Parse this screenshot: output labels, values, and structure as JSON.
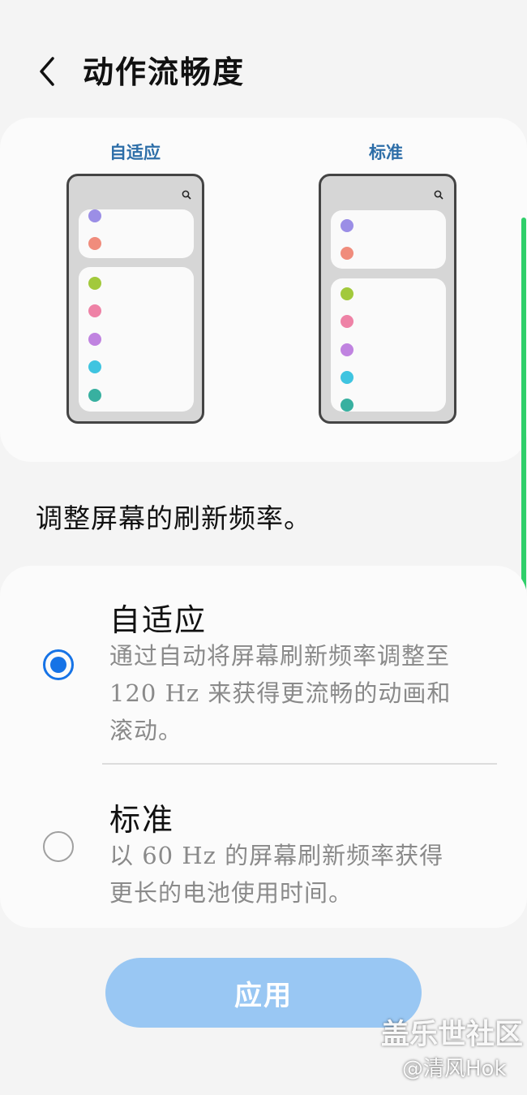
{
  "header": {
    "title": "动作流畅度",
    "back_icon": "chevron-left-icon"
  },
  "preview": {
    "adaptive_label": "自适应",
    "standard_label": "标准",
    "search_icon": "search-icon",
    "dot_colors": [
      "#9b8ee6",
      "#f08c7c",
      "#a2c93c",
      "#ee82a6",
      "#c083e0",
      "#3fc4e0",
      "#38b0a0"
    ]
  },
  "description": "调整屏幕的刷新频率。",
  "options": [
    {
      "title": "自适应",
      "desc_line1": "通过自动将屏幕刷新频率调整至",
      "desc_line2": "120 Hz 来获得更流畅的动画和",
      "desc_line3": "滚动。",
      "selected": true
    },
    {
      "title": "标准",
      "desc_line1": "以 60 Hz 的屏幕刷新频率获得",
      "desc_line2": "更长的电池使用时间。",
      "selected": false
    }
  ],
  "apply_label": "应用",
  "colors": {
    "accent": "#1673e6",
    "button_bg": "#99c7f3",
    "scroll_indicator": "#2fcf6a"
  },
  "watermark": {
    "line1": "盖乐世社区",
    "line2": "@清风Hok"
  }
}
